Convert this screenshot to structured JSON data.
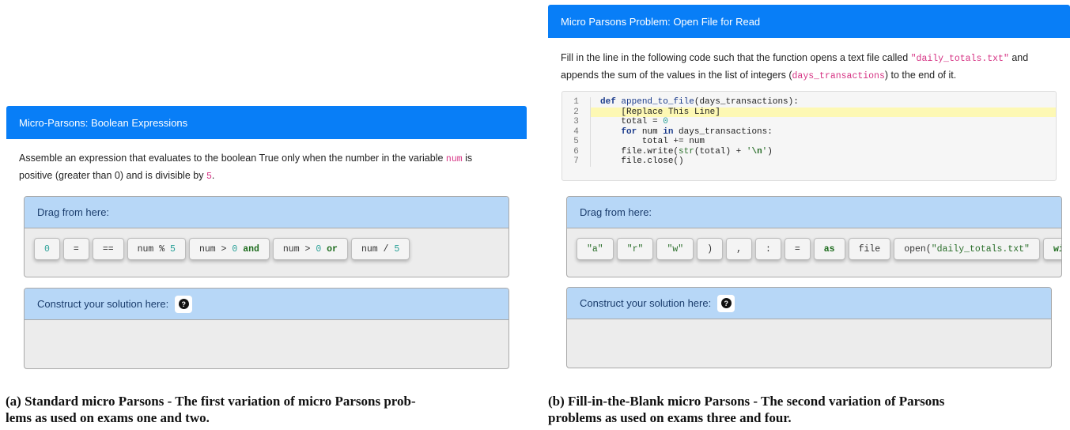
{
  "left": {
    "header": "Micro-Parsons: Boolean Expressions",
    "instr_1": "Assemble an expression that evaluates to the boolean True only when the number in the variable ",
    "instr_var": "num",
    "instr_2": " is",
    "instr_3": "positive (greater than 0) and is divisible by ",
    "instr_num": "5",
    "instr_4": ".",
    "drag_label": "Drag from here:",
    "tiles": [
      "0",
      "=",
      "==",
      "num % 5",
      "num > 0 and",
      "num > 0 or",
      "num / 5"
    ],
    "construct_label": "Construct your solution here:",
    "help_glyph": "?"
  },
  "right": {
    "header": "Micro Parsons Problem: Open File for Read",
    "instr_1": "Fill in the line in the following code such that the function opens a text file called ",
    "instr_file": "\"daily_totals.txt\"",
    "instr_2": " and",
    "instr_3": "appends the sum of the values in the list of integers (",
    "instr_var": "days_transactions",
    "instr_4": ") to the end of it.",
    "code_lines": [
      {
        "n": "1",
        "text": "def append_to_file(days_transactions):"
      },
      {
        "n": "2",
        "text": "    [Replace This Line]",
        "highlight": true
      },
      {
        "n": "3",
        "text": "    total = 0"
      },
      {
        "n": "4",
        "text": "    for num in days_transactions:"
      },
      {
        "n": "5",
        "text": "        total += num"
      },
      {
        "n": "6",
        "text": "    file.write(str(total) + '\\n')"
      },
      {
        "n": "7",
        "text": "    file.close()"
      }
    ],
    "drag_label": "Drag from here:",
    "tiles": [
      "\"a\"",
      "\"r\"",
      "\"w\"",
      ")",
      ",",
      ":",
      "=",
      "as",
      "file",
      "open(\"daily_totals.txt\"",
      "with"
    ],
    "construct_label": "Construct your solution here:",
    "help_glyph": "?"
  },
  "captions": {
    "a_line1": "(a) Standard micro Parsons - The first variation of micro Parsons prob-",
    "a_line2": "lems as used on exams one and two.",
    "b_line1": "(b) Fill-in-the-Blank micro Parsons - The second variation of Parsons",
    "b_line2": "problems as used on exams three and four."
  },
  "colors": {
    "header_blue": "#087ef7",
    "drag_header": "#b7d7f7",
    "highlight": "#fdf8b4"
  }
}
